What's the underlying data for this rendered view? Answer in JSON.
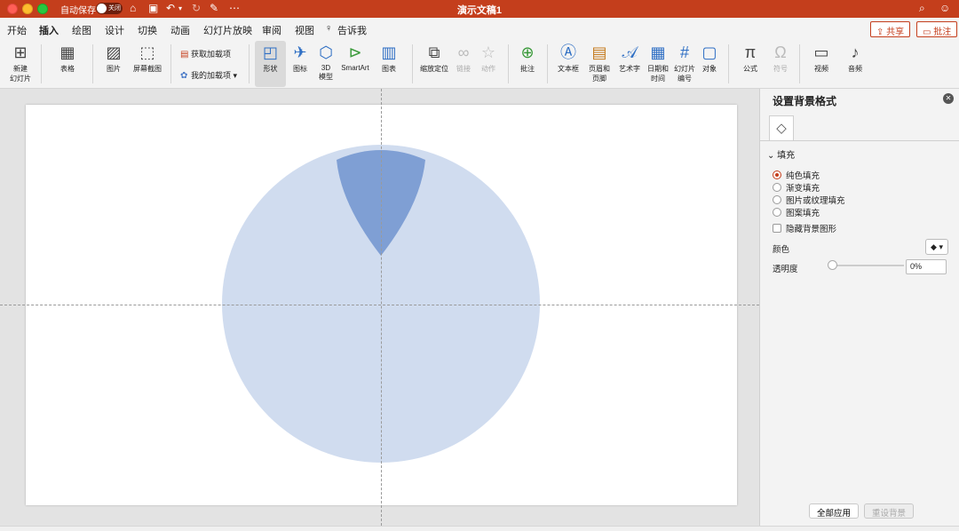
{
  "window": {
    "title": "演示文稿1",
    "autosave_label": "自动保存",
    "autosave_state": "关闭"
  },
  "tabs": [
    "开始",
    "插入",
    "绘图",
    "设计",
    "切换",
    "动画",
    "幻灯片放映",
    "审阅",
    "视图"
  ],
  "active_tab": "插入",
  "tell_me": "告诉我",
  "share_label": "共享",
  "comment_label": "批注",
  "ribbon": {
    "new_slide": "新建\n幻灯片",
    "table": "表格",
    "picture": "图片",
    "screenshot": "屏幕截图",
    "get_addins": "获取加载项",
    "my_addins": "我的加载项",
    "shapes": "形状",
    "icons": "图标",
    "model3d": "3D\n模型",
    "smartart": "SmartArt",
    "chart": "图表",
    "zoom": "缩放定位",
    "link": "链接",
    "action": "动作",
    "comment": "批注",
    "textbox": "文本框",
    "header_footer": "页眉和\n页脚",
    "wordart": "艺术字",
    "datetime": "日期和\n时间",
    "slide_number": "幻灯片\n编号",
    "object": "对象",
    "equation": "公式",
    "symbol": "符号",
    "video": "视频",
    "audio": "音频"
  },
  "pane": {
    "title": "设置背景格式",
    "section": "填充",
    "fill_options": [
      "纯色填充",
      "渐变填充",
      "图片或纹理填充",
      "图案填充"
    ],
    "selected_fill": "纯色填充",
    "hide_bg_graphics": "隐藏背景图形",
    "color_label": "颜色",
    "transparency_label": "透明度",
    "transparency_value": "0%",
    "apply_all": "全部应用",
    "reset_bg": "重设背景"
  },
  "colors": {
    "accent": "#c43e1c",
    "circle_fill": "#d0dcef",
    "petal_fill": "#7f9fd4"
  }
}
